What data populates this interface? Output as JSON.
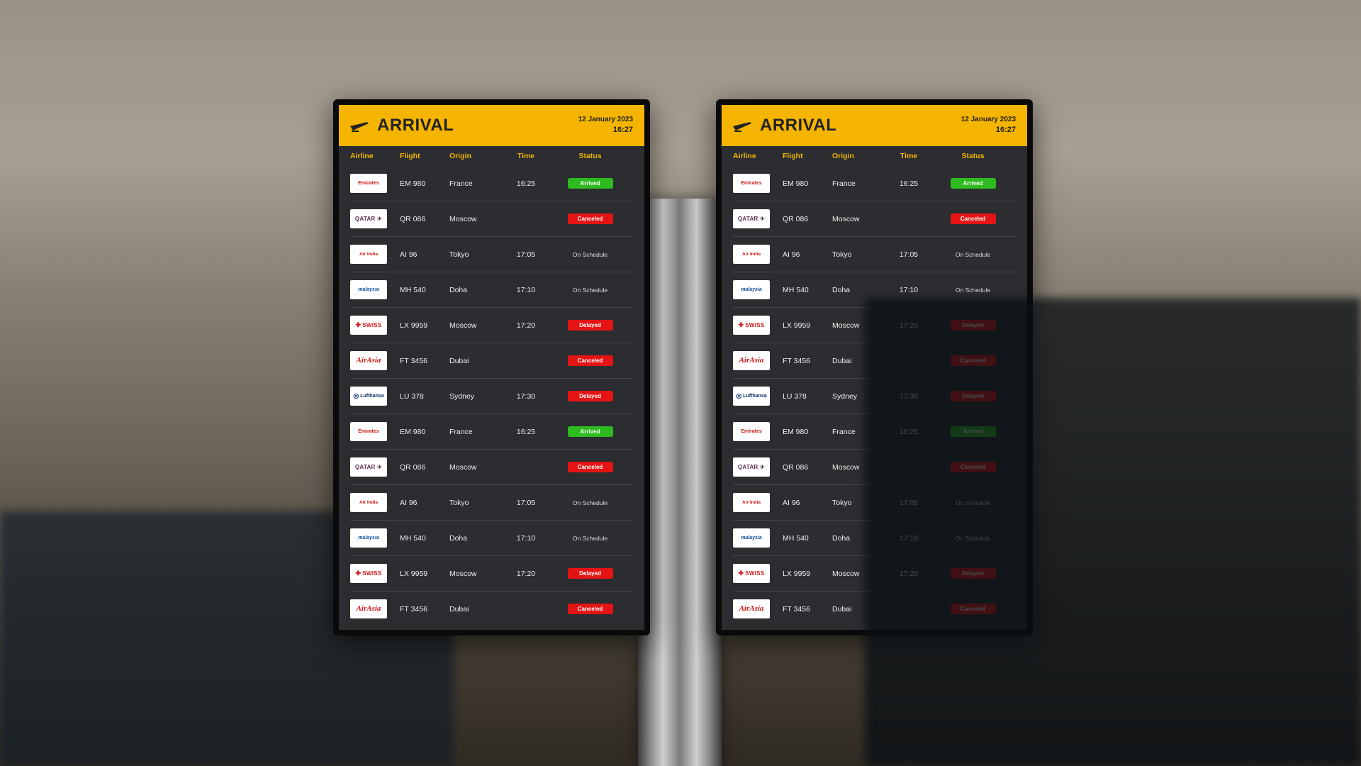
{
  "board": {
    "title": "ARRIVAL",
    "date": "12 January 2023",
    "time": "16:27",
    "header_color": "#f5b400",
    "header_text_color": "#f5b400",
    "columns": [
      "Airline",
      "Flight",
      "Origin",
      "Time",
      "Status"
    ],
    "rows": [
      {
        "logo_style": "red",
        "logo_text": "Emirates",
        "flight": "EM 980",
        "origin": "France",
        "time": "16:25",
        "status": "Arrived",
        "status_kind": "arrived"
      },
      {
        "logo_style": "qatar",
        "logo_text": "QATAR ✈",
        "flight": "QR 086",
        "origin": "Moscow",
        "time": "",
        "status": "Canceled",
        "status_kind": "canceled"
      },
      {
        "logo_style": "ai",
        "logo_text": "Air India",
        "flight": "AI 96",
        "origin": "Tokyo",
        "time": "17:05",
        "status": "On Schedule",
        "status_kind": "text"
      },
      {
        "logo_style": "my",
        "logo_text": "malaysia",
        "flight": "MH 540",
        "origin": "Doha",
        "time": "17:10",
        "status": "On Schedule",
        "status_kind": "text"
      },
      {
        "logo_style": "swiss",
        "logo_text": "SWISS",
        "flight": "LX 9959",
        "origin": "Moscow",
        "time": "17:20",
        "status": "Delayed",
        "status_kind": "delayed"
      },
      {
        "logo_style": "script",
        "logo_text": "AirAsia",
        "flight": "FT 3456",
        "origin": "Dubai",
        "time": "",
        "status": "Canceled",
        "status_kind": "canceled"
      },
      {
        "logo_style": "luft",
        "logo_text": "Lufthansa",
        "flight": "LU 378",
        "origin": "Sydney",
        "time": "17:30",
        "status": "Delayed",
        "status_kind": "delayed"
      },
      {
        "logo_style": "red",
        "logo_text": "Emirates",
        "flight": "EM 980",
        "origin": "France",
        "time": "16:25",
        "status": "Arrived",
        "status_kind": "arrived"
      },
      {
        "logo_style": "qatar",
        "logo_text": "QATAR ✈",
        "flight": "QR 086",
        "origin": "Moscow",
        "time": "",
        "status": "Canceled",
        "status_kind": "canceled"
      },
      {
        "logo_style": "ai",
        "logo_text": "Air India",
        "flight": "AI 96",
        "origin": "Tokyo",
        "time": "17:05",
        "status": "On Schedule",
        "status_kind": "text"
      },
      {
        "logo_style": "my",
        "logo_text": "malaysia",
        "flight": "MH 540",
        "origin": "Doha",
        "time": "17:10",
        "status": "On Schedule",
        "status_kind": "text"
      },
      {
        "logo_style": "swiss",
        "logo_text": "SWISS",
        "flight": "LX 9959",
        "origin": "Moscow",
        "time": "17:20",
        "status": "Delayed",
        "status_kind": "delayed"
      },
      {
        "logo_style": "script",
        "logo_text": "AirAsia",
        "flight": "FT 3456",
        "origin": "Dubai",
        "time": "",
        "status": "Canceled",
        "status_kind": "canceled"
      }
    ]
  },
  "displays": [
    "left",
    "right"
  ]
}
